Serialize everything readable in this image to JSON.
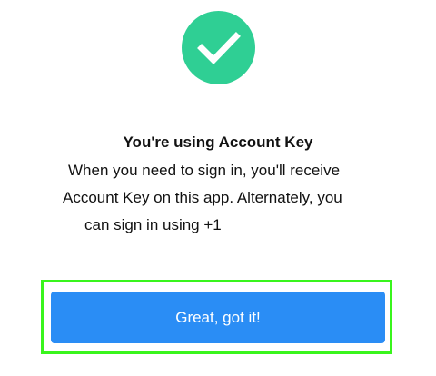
{
  "confirmation": {
    "icon": "checkmark-icon",
    "icon_color": "#2fcf94",
    "title": "You're using Account Key",
    "message_lines": [
      "When you need to sign in, you'll receive",
      "Account Key on this app. Alternately, you",
      "can sign in using +1"
    ]
  },
  "actions": {
    "primary_label": "Great, got it!",
    "primary_color": "#2a8df5",
    "highlight_color": "#39f51c"
  }
}
